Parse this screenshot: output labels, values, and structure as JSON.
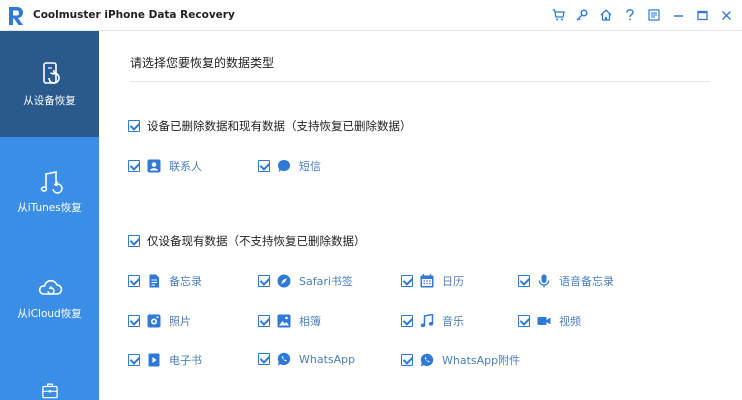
{
  "window": {
    "title": "Coolmuster iPhone Data Recovery",
    "accent_color": "#3a8ee6",
    "active_color": "#2a5a8c",
    "toolbar_icons": [
      "cart-icon",
      "key-icon",
      "home-icon",
      "help-icon",
      "feedback-icon",
      "minimize-icon",
      "maximize-icon",
      "close-icon"
    ]
  },
  "sidebar": {
    "items": [
      {
        "label": "从设备恢复",
        "icon": "phone-recover-icon",
        "active": true
      },
      {
        "label": "从iTunes恢复",
        "icon": "itunes-icon",
        "active": false
      },
      {
        "label": "从iCloud恢复",
        "icon": "icloud-icon",
        "active": false
      },
      {
        "label": "",
        "icon": "toolbox-icon",
        "active": false
      }
    ]
  },
  "main": {
    "title": "请选择您要恢复的数据类型",
    "sections": [
      {
        "label": "设备已删除数据和现有数据（支持恢复已删除数据）",
        "checked": true,
        "options": [
          {
            "label": "联系人",
            "icon": "contacts-icon",
            "checked": true
          },
          {
            "label": "短信",
            "icon": "messages-icon",
            "checked": true
          }
        ]
      },
      {
        "label": "仅设备现有数据（不支持恢复已删除数据）",
        "checked": true,
        "options": [
          {
            "label": "备忘录",
            "icon": "notes-icon",
            "checked": true
          },
          {
            "label": "Safari书签",
            "icon": "safari-icon",
            "checked": true
          },
          {
            "label": "日历",
            "icon": "calendar-icon",
            "checked": true
          },
          {
            "label": "语音备忘录",
            "icon": "microphone-icon",
            "checked": true
          },
          {
            "label": "照片",
            "icon": "camera-icon",
            "checked": true
          },
          {
            "label": "相簿",
            "icon": "album-icon",
            "checked": true
          },
          {
            "label": "音乐",
            "icon": "music-icon",
            "checked": true
          },
          {
            "label": "视频",
            "icon": "video-icon",
            "checked": true
          },
          {
            "label": "电子书",
            "icon": "ebook-icon",
            "checked": true
          },
          {
            "label": "WhatsApp",
            "icon": "whatsapp-icon",
            "checked": true
          },
          {
            "label": "WhatsApp附件",
            "icon": "whatsapp-attachment-icon",
            "checked": true
          }
        ]
      }
    ]
  }
}
